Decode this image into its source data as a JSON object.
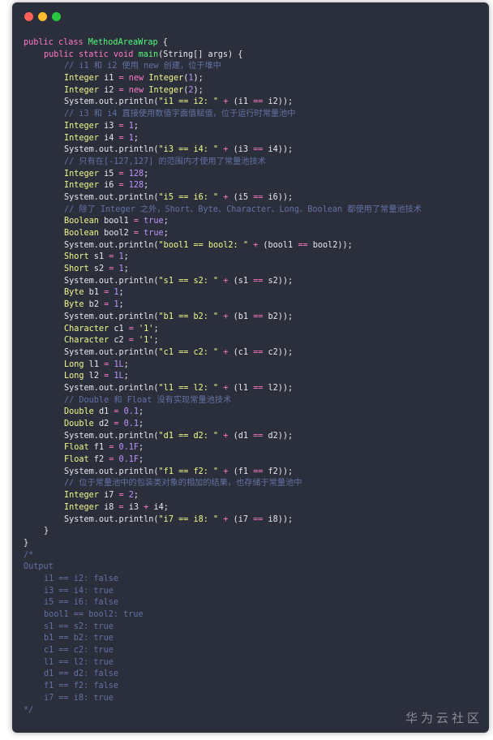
{
  "window": {
    "traffic_lights": {
      "close": "#ff5f57",
      "minimize": "#febc2e",
      "zoom": "#28c840"
    },
    "background": "#2b2e3b"
  },
  "code": {
    "class_decl": {
      "kw1": "public",
      "kw2": "class",
      "name": "MethodAreaWrap",
      "open": " {"
    },
    "main_decl": {
      "kw1": "public",
      "kw2": "static",
      "kw3": "void",
      "name": "main",
      "params": "(String[] args) {"
    },
    "c1": "// i1 和 i2 使用 new 创建，位于堆中",
    "c2": "// i3 和 i4 直接使用数值字面值赋值，位于运行时常量池中",
    "c3": "// 只有在[-127,127] 的范围内才使用了常量池技术",
    "c4": "// 除了 Integer 之外，Short、Byte、Character、Long、Boolean 都使用了常量池技术",
    "c5": "// Double 和 Float 没有实现常量池技术",
    "c6": "// 位于常量池中的包装类对象的相加的结果，也存储于常量池中",
    "close_main": "}",
    "close_class": "}",
    "comment_open": "/*",
    "output_label": "Output",
    "comment_close": "*/",
    "output": [
      "i1 == i2: false",
      "i3 == i4: true",
      "i5 == i6: false",
      "bool1 == bool2: true",
      "s1 == s2: true",
      "b1 == b2: true",
      "c1 == c2: true",
      "l1 == l2: true",
      "d1 == d2: false",
      "f1 == f2: false",
      "i7 == i8: true"
    ]
  },
  "watermark": "华为云社区"
}
